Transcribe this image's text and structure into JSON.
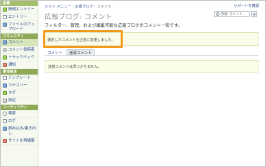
{
  "sidebar": {
    "sections": [
      {
        "title": "投稿",
        "items": [
          {
            "label": "新規エントリー",
            "icon": "new-entry-icon"
          },
          {
            "label": "エントリー",
            "icon": "entries-icon"
          },
          {
            "label": "ファイルのアップロード",
            "icon": "upload-file-icon"
          }
        ]
      },
      {
        "title": "コミュニティ",
        "items": [
          {
            "label": "コメント",
            "icon": "comments-icon"
          },
          {
            "label": "コメント投稿者",
            "icon": "commenters-icon"
          },
          {
            "label": "トラックバック",
            "icon": "trackbacks-icon"
          },
          {
            "label": "通知",
            "icon": "notifications-icon"
          }
        ]
      },
      {
        "title": "書体設定",
        "items": [
          {
            "label": "テンプレート",
            "icon": "templates-icon"
          },
          {
            "label": "カテゴリー",
            "icon": "categories-icon"
          },
          {
            "label": "タグ",
            "icon": "tags-icon"
          },
          {
            "label": "設定",
            "icon": "settings-icon"
          }
        ]
      },
      {
        "title": "ユーティリティ",
        "items": [
          {
            "label": "検索",
            "icon": "search-icon"
          },
          {
            "label": "ログ",
            "icon": "logs-icon"
          },
          {
            "label": "読み込み/書き出し",
            "icon": "import-export-icon"
          },
          {
            "label": "サイトを再構築",
            "icon": "rebuild-site-icon"
          }
        ]
      }
    ]
  },
  "header": {
    "breadcrumb": [
      "メイン メニュー",
      "広報ブログ",
      "コメント"
    ],
    "bug_report": "サポートを確認",
    "search_placeholder": "検索 コメント"
  },
  "main": {
    "title": "広報ブログ: コメント",
    "description": "フィルター、管理、および編集可能な広報ブログのコメント一覧です。",
    "success_message": "選択したコメントを正常に変更しました。",
    "tabs": [
      "コメント",
      "迷惑コメント"
    ],
    "active_tab": 1,
    "empty_message": "迷惑コメントは見つかりません。"
  },
  "colors": {
    "highlight": "#f49a1a",
    "sidebar_header": "#8fa957",
    "message_bg": "#fbfde8"
  }
}
